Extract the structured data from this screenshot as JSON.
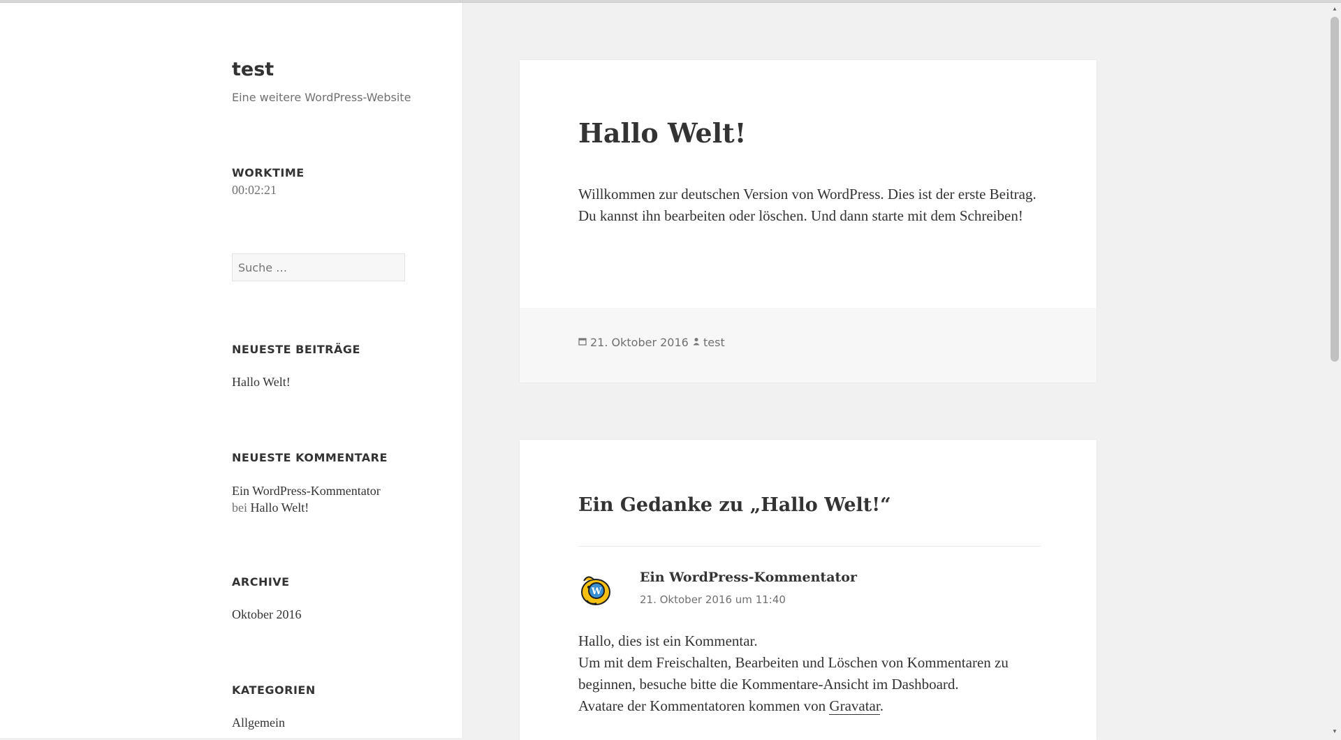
{
  "site": {
    "title": "test",
    "description": "Eine weitere WordPress-Website"
  },
  "sidebar": {
    "worktime": {
      "title": "WORKTIME",
      "value": "00:02:21"
    },
    "search": {
      "placeholder": "Suche …"
    },
    "recent_posts": {
      "title": "NEUESTE BEITRÄGE",
      "items": [
        "Hallo Welt!"
      ]
    },
    "recent_comments": {
      "title": "NEUESTE KOMMENTARE",
      "author": "Ein WordPress-Kommentator",
      "connector": "bei",
      "post": "Hallo Welt!"
    },
    "archive": {
      "title": "ARCHIVE",
      "items": [
        "Oktober 2016"
      ]
    },
    "categories": {
      "title": "KATEGORIEN",
      "items": [
        "Allgemein"
      ]
    }
  },
  "post": {
    "title": "Hallo Welt!",
    "body": "Willkommen zur deutschen Version von WordPress. Dies ist der erste Beitrag. Du kannst ihn bearbeiten oder löschen. Und dann starte mit dem Schreiben!",
    "date": "21. Oktober 2016",
    "author": "test"
  },
  "comments": {
    "title": "Ein Gedanke zu „Hallo Welt!“",
    "items": [
      {
        "author": "Ein WordPress-Kommentator",
        "date": "21. Oktober 2016 um 11:40",
        "line1": "Hallo, dies ist ein Kommentar.",
        "line2": "Um mit dem Freischalten, Bearbeiten und Löschen von Kommentaren zu beginnen, besuche bitte die Kommentare-Ansicht im Dashboard.",
        "line3_prefix": "Avatare der Kommentatoren kommen von",
        "link": "Gravatar",
        "line3_suffix": "."
      }
    ]
  },
  "icons": {
    "date": "calendar-icon",
    "author": "user-icon",
    "scroll_up": "triangle-up",
    "scroll_down": "triangle-down"
  },
  "colors": {
    "page_background": "#f1f1f1",
    "card_background": "#ffffff",
    "text": "#333333",
    "muted_text": "#707070",
    "footer_background": "#f7f7f7"
  }
}
